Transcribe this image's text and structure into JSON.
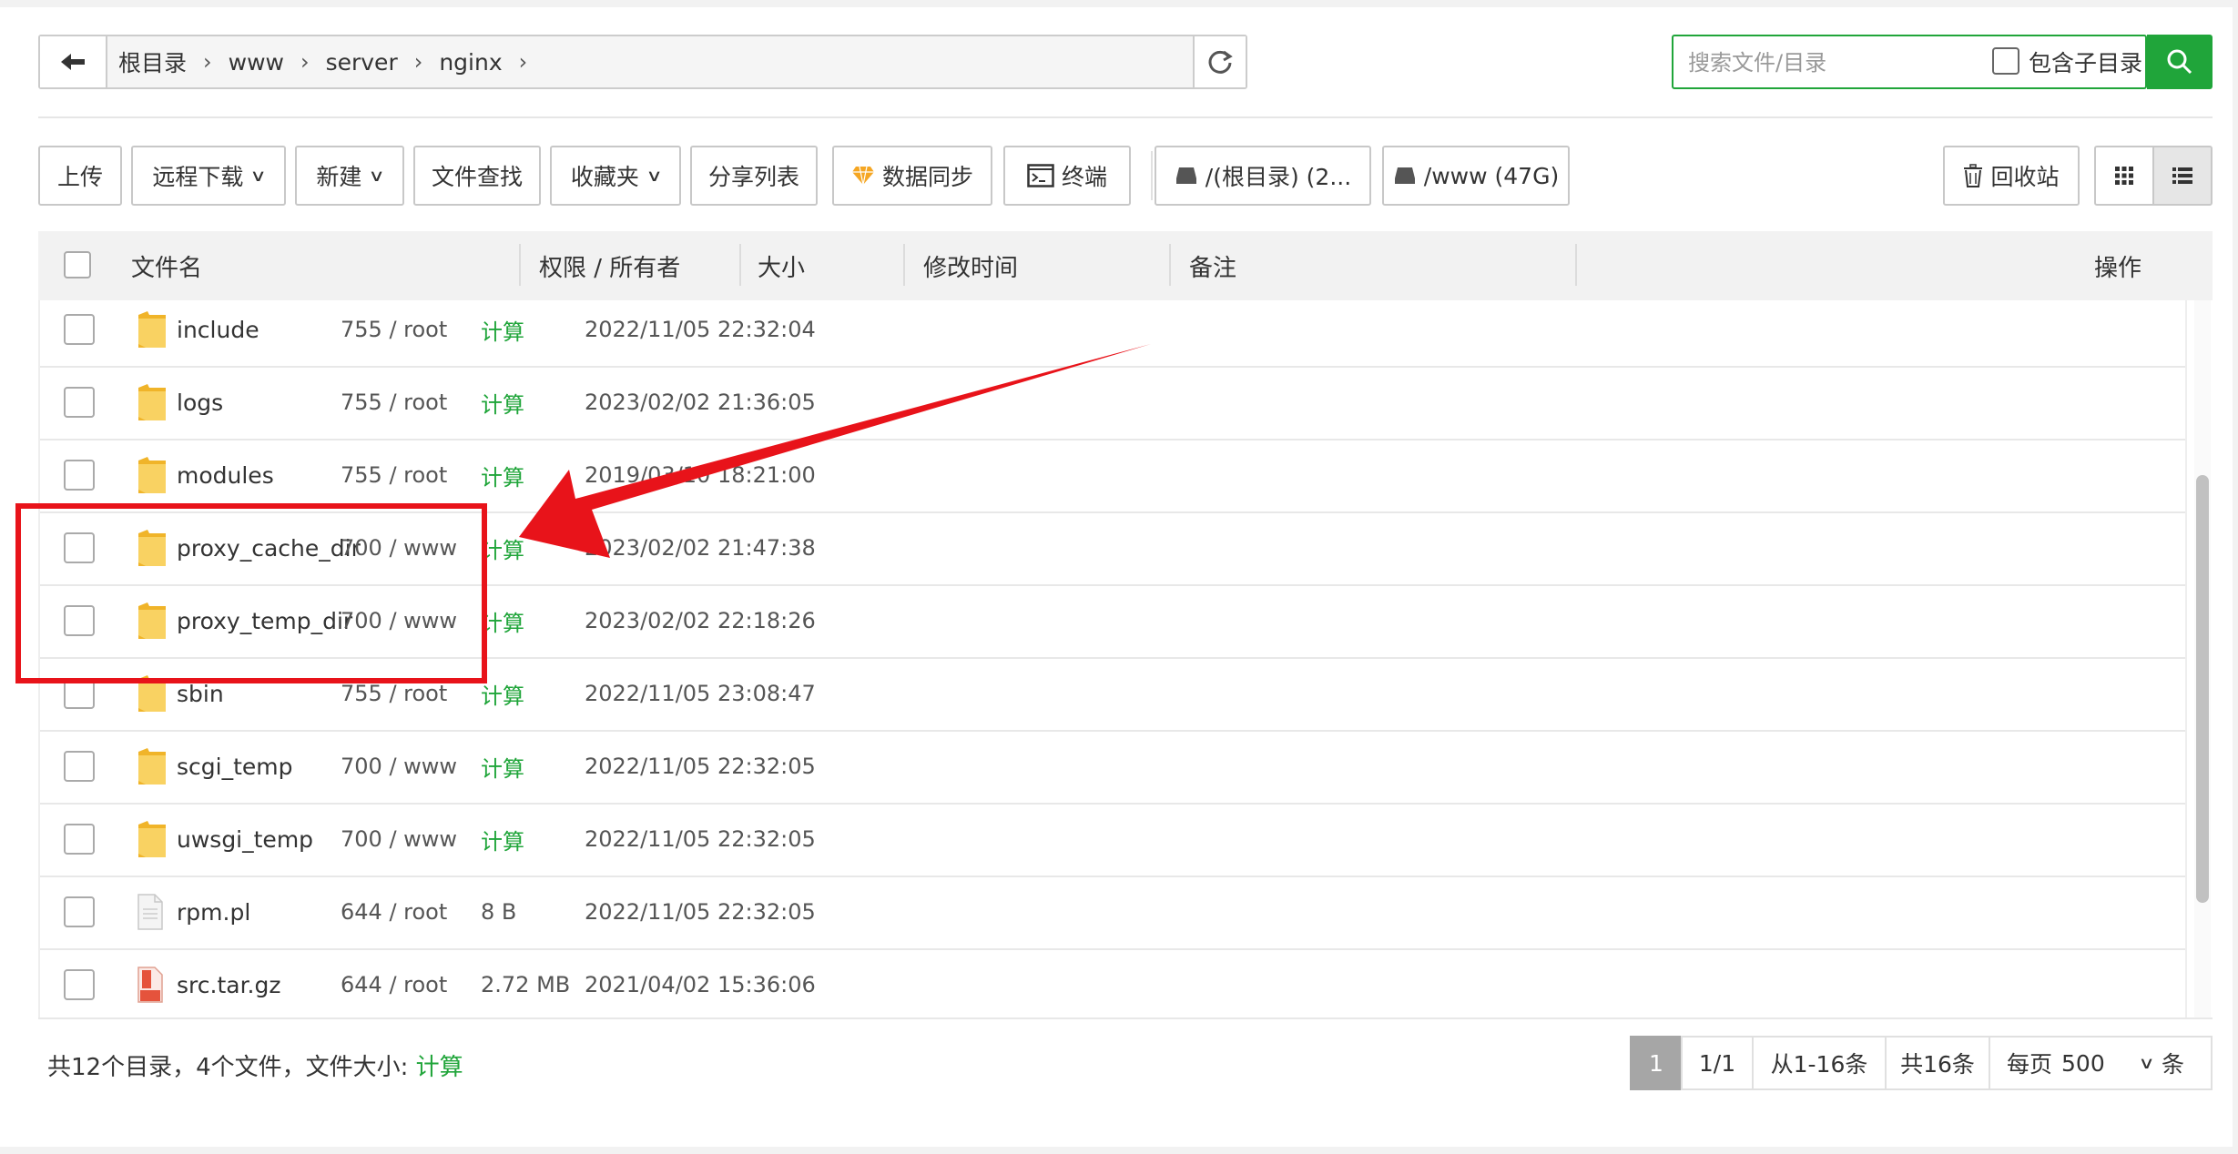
{
  "breadcrumb": {
    "items": [
      "根目录",
      "www",
      "server",
      "nginx"
    ]
  },
  "search": {
    "placeholder": "搜索文件/目录",
    "include_subdir_label": "包含子目录"
  },
  "toolbar": {
    "upload": "上传",
    "remote_download": "远程下载",
    "new": "新建",
    "file_search": "文件查找",
    "favorites": "收藏夹",
    "share_list": "分享列表",
    "data_sync": "数据同步",
    "terminal": "终端",
    "disk_root": "/(根目录) (2...",
    "disk_www": "/www (47G)",
    "recycle_bin": "回收站"
  },
  "table": {
    "headers": {
      "name": "文件名",
      "perm": "权限 / 所有者",
      "size": "大小",
      "mtime": "修改时间",
      "note": "备注",
      "ops": "操作"
    },
    "rows": [
      {
        "name": "include",
        "type": "folder",
        "perm": "755 / root",
        "size": "计算",
        "mtime": "2022/11/05 22:32:04"
      },
      {
        "name": "logs",
        "type": "folder",
        "perm": "755 / root",
        "size": "计算",
        "mtime": "2023/02/02 21:36:05"
      },
      {
        "name": "modules",
        "type": "folder",
        "perm": "755 / root",
        "size": "计算",
        "mtime": "2019/03/10 18:21:00"
      },
      {
        "name": "proxy_cache_dir",
        "type": "folder",
        "perm": "700 / www",
        "size": "计算",
        "mtime": "2023/02/02 21:47:38"
      },
      {
        "name": "proxy_temp_dir",
        "type": "folder",
        "perm": "700 / www",
        "size": "计算",
        "mtime": "2023/02/02 22:18:26"
      },
      {
        "name": "sbin",
        "type": "folder",
        "perm": "755 / root",
        "size": "计算",
        "mtime": "2022/11/05 23:08:47"
      },
      {
        "name": "scgi_temp",
        "type": "folder",
        "perm": "700 / www",
        "size": "计算",
        "mtime": "2022/11/05 22:32:05"
      },
      {
        "name": "uwsgi_temp",
        "type": "folder",
        "perm": "700 / www",
        "size": "计算",
        "mtime": "2022/11/05 22:32:05"
      },
      {
        "name": "rpm.pl",
        "type": "file",
        "perm": "644 / root",
        "size": "8 B",
        "mtime": "2022/11/05 22:32:05"
      },
      {
        "name": "src.tar.gz",
        "type": "archive",
        "perm": "644 / root",
        "size": "2.72 MB",
        "mtime": "2021/04/02 15:36:06"
      }
    ]
  },
  "footer": {
    "summary_prefix": "共12个目录，4个文件，文件大小: ",
    "summary_calc": "计算",
    "page_current": "1",
    "page_total": "1/1",
    "range": "从1-16条",
    "total": "共16条",
    "per_page_label": "每页",
    "per_page_value": "500",
    "per_page_suffix": "条"
  },
  "colors": {
    "accent_green": "#20a53a",
    "annotation_red": "#e8131a",
    "folder_yellow": "#f5c84c"
  }
}
